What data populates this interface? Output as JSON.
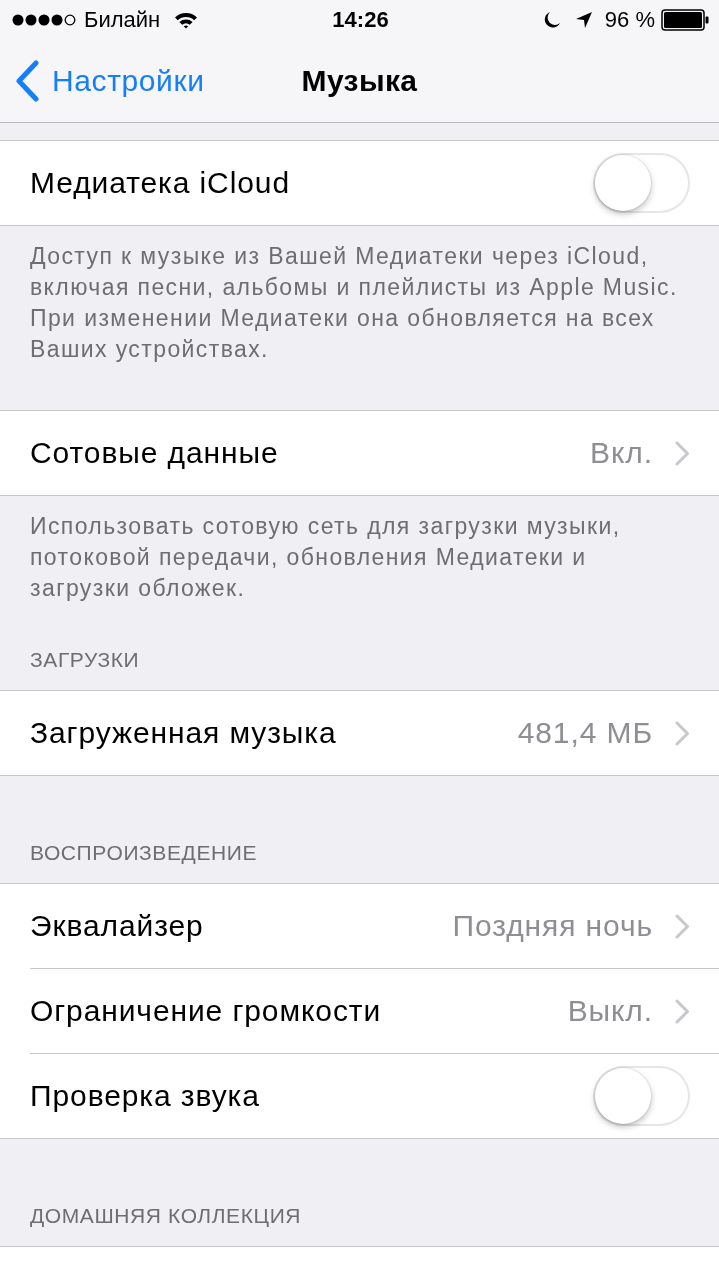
{
  "status_bar": {
    "carrier": "Билайн",
    "time": "14:26",
    "battery": "96 %"
  },
  "nav_bar": {
    "back": "Настройки",
    "title": "Музыка"
  },
  "sections": [
    {
      "rows": [
        {
          "kind": "toggle",
          "label": "Медиатека iCloud",
          "on": false
        }
      ],
      "footer": "Доступ к музыке из Вашей Медиатеки через iCloud, включая песни, альбомы и плейлисты из Apple Music. При изменении Медиатеки она обновляется на всех Ваших устройствах."
    },
    {
      "rows": [
        {
          "kind": "link",
          "label": "Сотовые данные",
          "value": "Вкл."
        }
      ],
      "footer": "Использовать сотовую сеть для загрузки музыки, потоковой передачи, обновления Медиатеки и загрузки обложек."
    },
    {
      "header": "ЗАГРУЗКИ",
      "rows": [
        {
          "kind": "link",
          "label": "Загруженная музыка",
          "value": "481,4 МБ"
        }
      ]
    },
    {
      "header": "ВОСПРОИЗВЕДЕНИЕ",
      "rows": [
        {
          "kind": "link",
          "label": "Эквалайзер",
          "value": "Поздняя ночь"
        },
        {
          "kind": "link",
          "label": "Ограничение громкости",
          "value": "Выкл."
        },
        {
          "kind": "toggle",
          "label": "Проверка звука",
          "on": false
        }
      ]
    },
    {
      "header": "ДОМАШНЯЯ КОЛЛЕКЦИЯ",
      "rows": [
        {
          "kind": "cut_off"
        }
      ]
    }
  ]
}
